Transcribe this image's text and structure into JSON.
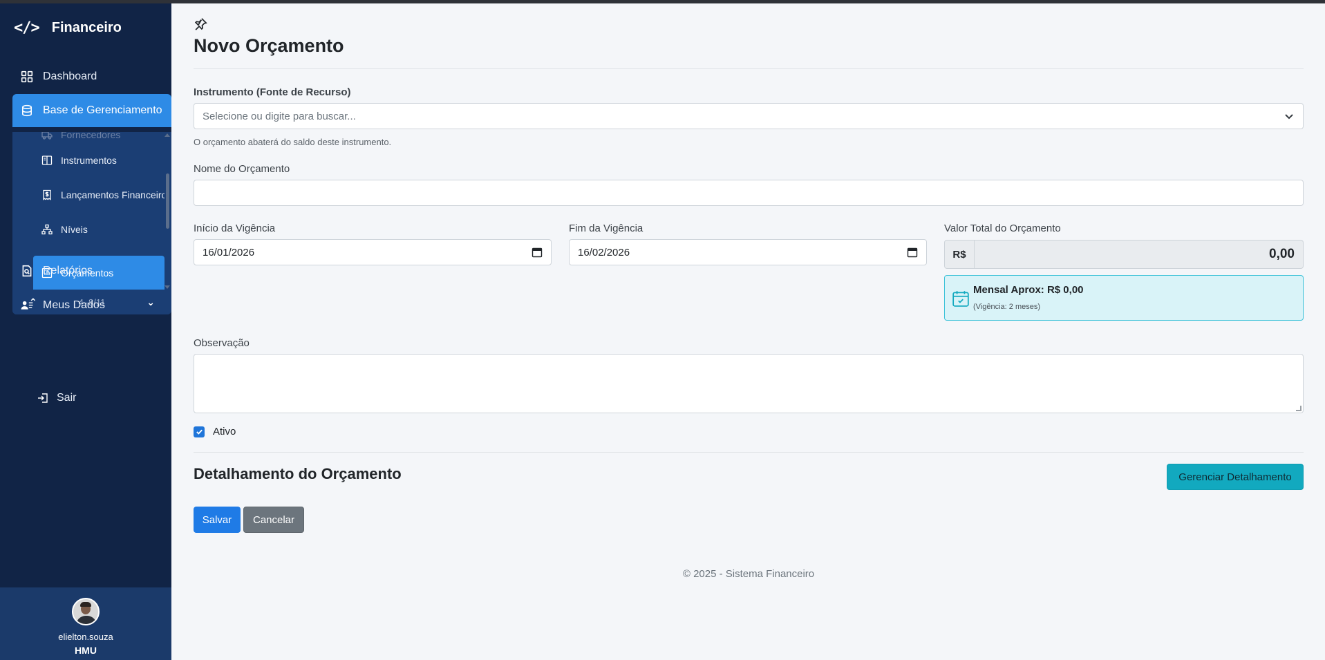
{
  "app": {
    "brand_title": "Financeiro"
  },
  "sidebar": {
    "dashboard": "Dashboard",
    "base": "Base de Gerenciamento",
    "submenu": {
      "faded": "Fornecedores",
      "items": [
        "Instrumentos",
        "Lançamentos Financeiros",
        "Níveis",
        "Orçamentos"
      ],
      "pager": "4–8/11"
    },
    "relatorios": "Relatórios",
    "meus_dados": "Meus Dados",
    "sair": "Sair",
    "user": {
      "name": "elielton.souza",
      "org": "HMU"
    }
  },
  "form": {
    "title": "Novo Orçamento",
    "instrumento": {
      "label": "Instrumento (Fonte de Recurso)",
      "placeholder": "Selecione ou digite para buscar...",
      "hint": "O orçamento abaterá do saldo deste instrumento."
    },
    "nome": {
      "label": "Nome do Orçamento",
      "value": ""
    },
    "inicio": {
      "label": "Início da Vigência",
      "value": "16/01/2026"
    },
    "fim": {
      "label": "Fim da Vigência",
      "value": "16/02/2026"
    },
    "valor": {
      "label": "Valor Total do Orçamento",
      "prefix": "R$",
      "value": "0,00"
    },
    "mensal": {
      "main": "Mensal Aprox: R$ 0,00",
      "sub": "(Vigência: 2 meses)"
    },
    "observacao": {
      "label": "Observação",
      "value": ""
    },
    "ativo": {
      "label": "Ativo",
      "checked": true
    },
    "detalhamento": {
      "title": "Detalhamento do Orçamento",
      "button": "Gerenciar Detalhamento"
    },
    "actions": {
      "save": "Salvar",
      "cancel": "Cancelar"
    }
  },
  "footer": "© 2025 - Sistema Financeiro",
  "colors": {
    "sidebar": "#112446",
    "accent": "#2e8be6",
    "info": "#12a9bf",
    "info_bg": "#d9f3f8"
  }
}
